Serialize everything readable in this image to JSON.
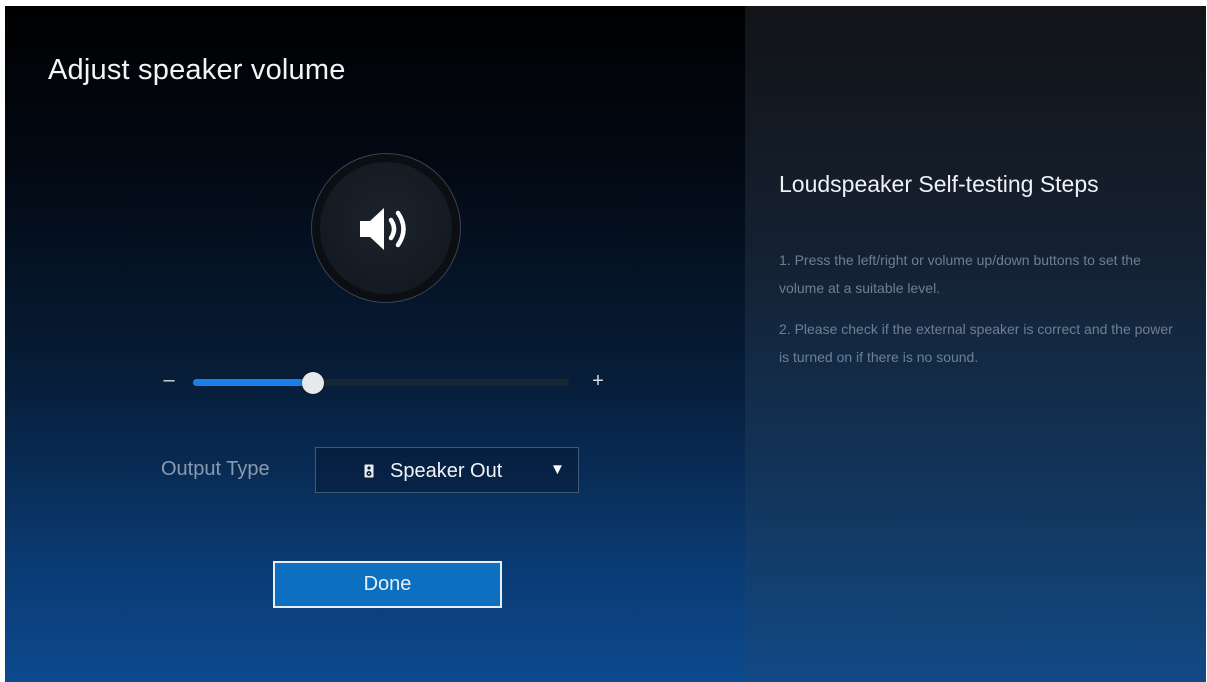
{
  "screen": {
    "title": "Adjust speaker volume"
  },
  "speaker": {
    "icon": "speaker-volume-icon"
  },
  "volume": {
    "minus_label": "–",
    "plus_label": "+",
    "level_percent": 32
  },
  "output": {
    "label": "Output Type",
    "selected": "Speaker Out",
    "icon": "speaker-box-icon",
    "caret": "▼"
  },
  "done_label": "Done",
  "help": {
    "title": "Loudspeaker Self-testing Steps",
    "steps": [
      "1. Press the left/right or volume up/down buttons to set the volume at a suitable level.",
      "2. Please check if the external speaker is correct and the power is turned on if there is no sound."
    ]
  },
  "colors": {
    "accent": "#1a7fe8",
    "done_button": "#0d6fbf"
  }
}
